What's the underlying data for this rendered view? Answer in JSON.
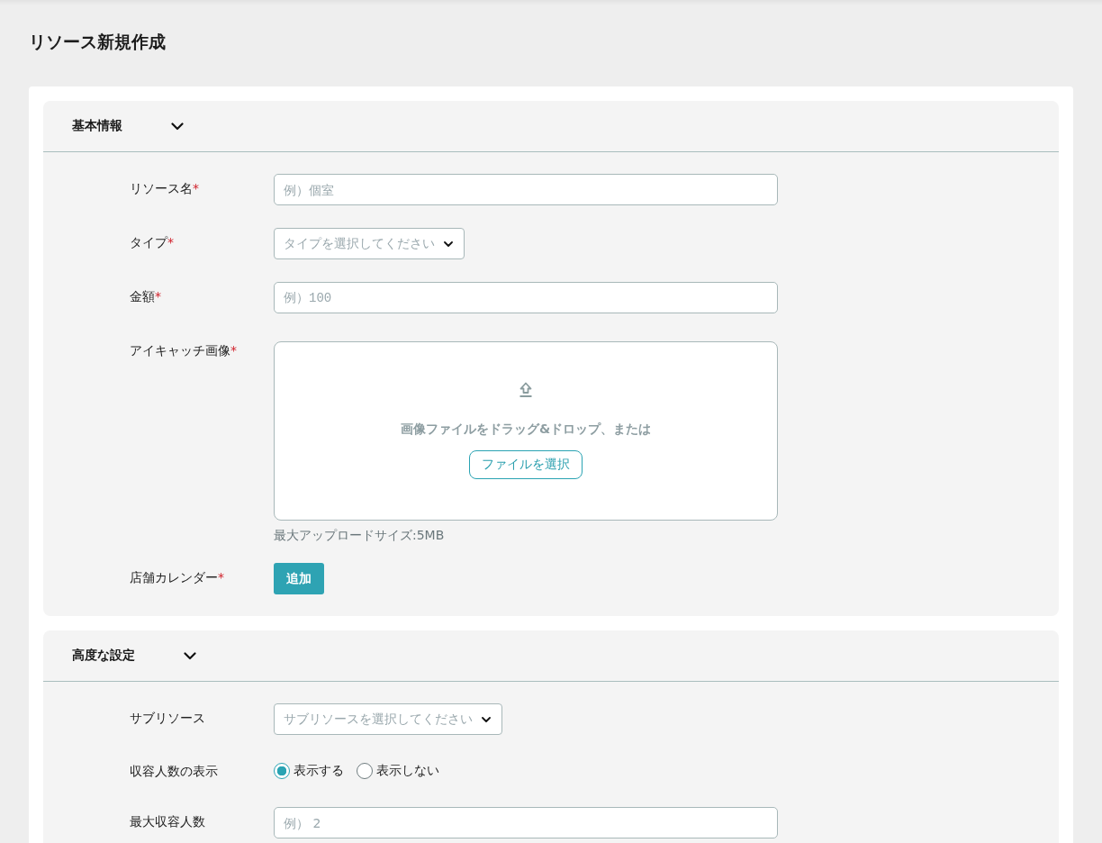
{
  "page_title": "リソース新規作成",
  "sections": [
    {
      "title": "基本情報",
      "expanded": true,
      "fields": [
        {
          "kind": "text",
          "label": "リソース名",
          "required_mark": "*",
          "placeholder": "例）個室"
        },
        {
          "kind": "select",
          "label": "タイプ",
          "required_mark": "*",
          "placeholder": "タイプを選択してください"
        },
        {
          "kind": "number",
          "label": "金額",
          "required_mark": "*",
          "placeholder": "例）100"
        },
        {
          "kind": "upload",
          "label": "アイキャッチ画像",
          "required_mark": "*",
          "prompt": "画像ファイルをドラッグ&ドロップ、または",
          "button": "ファイルを選択",
          "note": "最大アップロードサイズ:5MB"
        },
        {
          "kind": "button",
          "label": "店舗カレンダー",
          "required_mark": "*",
          "button": "追加"
        }
      ]
    },
    {
      "title": "高度な設定",
      "expanded": true,
      "fields": [
        {
          "kind": "select",
          "label": "サブリソース",
          "placeholder": "サブリソースを選択してください"
        },
        {
          "kind": "radio",
          "label": "収容人数の表示",
          "options": [
            {
              "label": "表示する",
              "selected": true
            },
            {
              "label": "表示しない",
              "selected": false
            }
          ]
        },
        {
          "kind": "text",
          "label": "最大収容人数",
          "placeholder": "例） 2"
        }
      ]
    }
  ]
}
